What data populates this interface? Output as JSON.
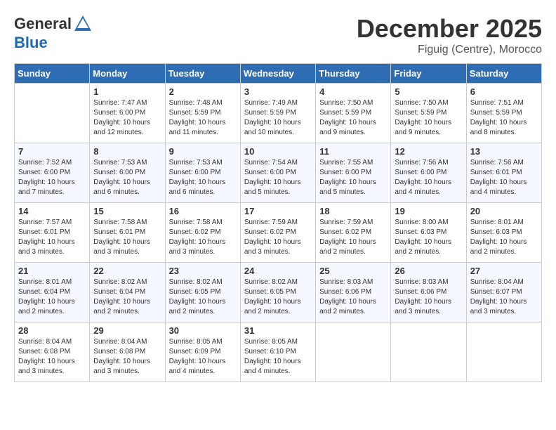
{
  "header": {
    "logo_general": "General",
    "logo_blue": "Blue",
    "month": "December 2025",
    "location": "Figuig (Centre), Morocco"
  },
  "weekdays": [
    "Sunday",
    "Monday",
    "Tuesday",
    "Wednesday",
    "Thursday",
    "Friday",
    "Saturday"
  ],
  "weeks": [
    [
      {
        "day": "",
        "info": ""
      },
      {
        "day": "1",
        "info": "Sunrise: 7:47 AM\nSunset: 6:00 PM\nDaylight: 10 hours\nand 12 minutes."
      },
      {
        "day": "2",
        "info": "Sunrise: 7:48 AM\nSunset: 5:59 PM\nDaylight: 10 hours\nand 11 minutes."
      },
      {
        "day": "3",
        "info": "Sunrise: 7:49 AM\nSunset: 5:59 PM\nDaylight: 10 hours\nand 10 minutes."
      },
      {
        "day": "4",
        "info": "Sunrise: 7:50 AM\nSunset: 5:59 PM\nDaylight: 10 hours\nand 9 minutes."
      },
      {
        "day": "5",
        "info": "Sunrise: 7:50 AM\nSunset: 5:59 PM\nDaylight: 10 hours\nand 9 minutes."
      },
      {
        "day": "6",
        "info": "Sunrise: 7:51 AM\nSunset: 5:59 PM\nDaylight: 10 hours\nand 8 minutes."
      }
    ],
    [
      {
        "day": "7",
        "info": "Sunrise: 7:52 AM\nSunset: 6:00 PM\nDaylight: 10 hours\nand 7 minutes."
      },
      {
        "day": "8",
        "info": "Sunrise: 7:53 AM\nSunset: 6:00 PM\nDaylight: 10 hours\nand 6 minutes."
      },
      {
        "day": "9",
        "info": "Sunrise: 7:53 AM\nSunset: 6:00 PM\nDaylight: 10 hours\nand 6 minutes."
      },
      {
        "day": "10",
        "info": "Sunrise: 7:54 AM\nSunset: 6:00 PM\nDaylight: 10 hours\nand 5 minutes."
      },
      {
        "day": "11",
        "info": "Sunrise: 7:55 AM\nSunset: 6:00 PM\nDaylight: 10 hours\nand 5 minutes."
      },
      {
        "day": "12",
        "info": "Sunrise: 7:56 AM\nSunset: 6:00 PM\nDaylight: 10 hours\nand 4 minutes."
      },
      {
        "day": "13",
        "info": "Sunrise: 7:56 AM\nSunset: 6:01 PM\nDaylight: 10 hours\nand 4 minutes."
      }
    ],
    [
      {
        "day": "14",
        "info": "Sunrise: 7:57 AM\nSunset: 6:01 PM\nDaylight: 10 hours\nand 3 minutes."
      },
      {
        "day": "15",
        "info": "Sunrise: 7:58 AM\nSunset: 6:01 PM\nDaylight: 10 hours\nand 3 minutes."
      },
      {
        "day": "16",
        "info": "Sunrise: 7:58 AM\nSunset: 6:02 PM\nDaylight: 10 hours\nand 3 minutes."
      },
      {
        "day": "17",
        "info": "Sunrise: 7:59 AM\nSunset: 6:02 PM\nDaylight: 10 hours\nand 3 minutes."
      },
      {
        "day": "18",
        "info": "Sunrise: 7:59 AM\nSunset: 6:02 PM\nDaylight: 10 hours\nand 2 minutes."
      },
      {
        "day": "19",
        "info": "Sunrise: 8:00 AM\nSunset: 6:03 PM\nDaylight: 10 hours\nand 2 minutes."
      },
      {
        "day": "20",
        "info": "Sunrise: 8:01 AM\nSunset: 6:03 PM\nDaylight: 10 hours\nand 2 minutes."
      }
    ],
    [
      {
        "day": "21",
        "info": "Sunrise: 8:01 AM\nSunset: 6:04 PM\nDaylight: 10 hours\nand 2 minutes."
      },
      {
        "day": "22",
        "info": "Sunrise: 8:02 AM\nSunset: 6:04 PM\nDaylight: 10 hours\nand 2 minutes."
      },
      {
        "day": "23",
        "info": "Sunrise: 8:02 AM\nSunset: 6:05 PM\nDaylight: 10 hours\nand 2 minutes."
      },
      {
        "day": "24",
        "info": "Sunrise: 8:02 AM\nSunset: 6:05 PM\nDaylight: 10 hours\nand 2 minutes."
      },
      {
        "day": "25",
        "info": "Sunrise: 8:03 AM\nSunset: 6:06 PM\nDaylight: 10 hours\nand 2 minutes."
      },
      {
        "day": "26",
        "info": "Sunrise: 8:03 AM\nSunset: 6:06 PM\nDaylight: 10 hours\nand 3 minutes."
      },
      {
        "day": "27",
        "info": "Sunrise: 8:04 AM\nSunset: 6:07 PM\nDaylight: 10 hours\nand 3 minutes."
      }
    ],
    [
      {
        "day": "28",
        "info": "Sunrise: 8:04 AM\nSunset: 6:08 PM\nDaylight: 10 hours\nand 3 minutes."
      },
      {
        "day": "29",
        "info": "Sunrise: 8:04 AM\nSunset: 6:08 PM\nDaylight: 10 hours\nand 3 minutes."
      },
      {
        "day": "30",
        "info": "Sunrise: 8:05 AM\nSunset: 6:09 PM\nDaylight: 10 hours\nand 4 minutes."
      },
      {
        "day": "31",
        "info": "Sunrise: 8:05 AM\nSunset: 6:10 PM\nDaylight: 10 hours\nand 4 minutes."
      },
      {
        "day": "",
        "info": ""
      },
      {
        "day": "",
        "info": ""
      },
      {
        "day": "",
        "info": ""
      }
    ]
  ]
}
